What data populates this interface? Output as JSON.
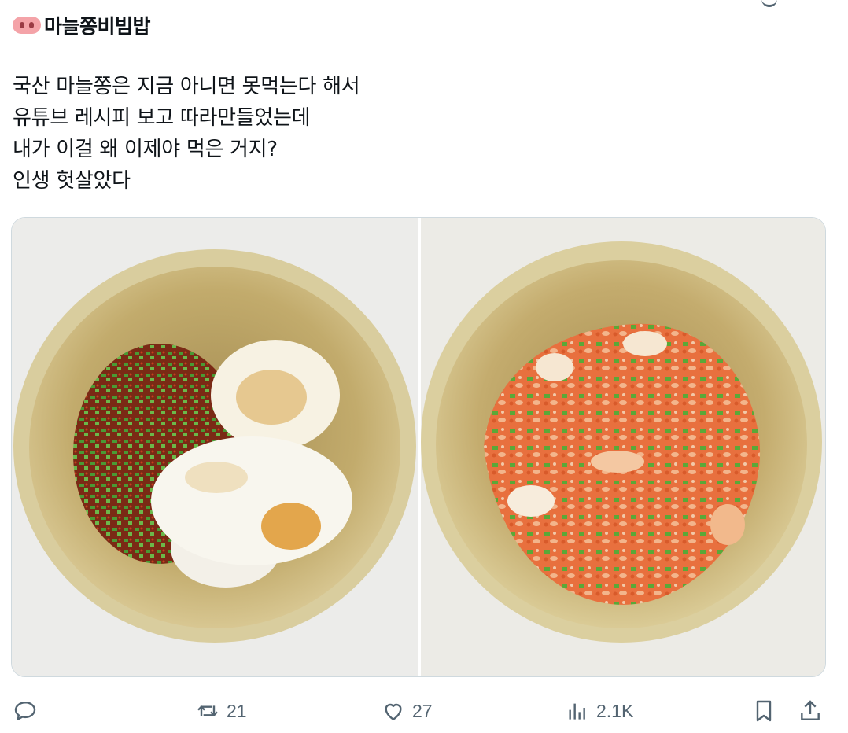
{
  "post": {
    "title_emoji": "pig-nose-icon",
    "title": "마늘쫑비빔밥",
    "lines": [
      "국산 마늘쫑은 지금 아니면 못먹는다 해서",
      "유튜브 레시피 보고 따라만들었는데",
      "내가 이걸 왜 이제야 먹은 거지?",
      "인생 헛살았다"
    ]
  },
  "media": {
    "images": [
      "photo-before-mixing",
      "photo-after-mixing"
    ]
  },
  "actions": {
    "reply": {
      "icon": "reply-icon"
    },
    "retweet": {
      "icon": "retweet-icon",
      "count": "21"
    },
    "like": {
      "icon": "heart-icon",
      "count": "27"
    },
    "views": {
      "icon": "views-icon",
      "count": "2.1K"
    },
    "bookmark": {
      "icon": "bookmark-icon"
    },
    "share": {
      "icon": "share-icon"
    }
  },
  "colors": {
    "text": "#0f1419",
    "muted": "#536471",
    "border": "#cfd9de"
  }
}
